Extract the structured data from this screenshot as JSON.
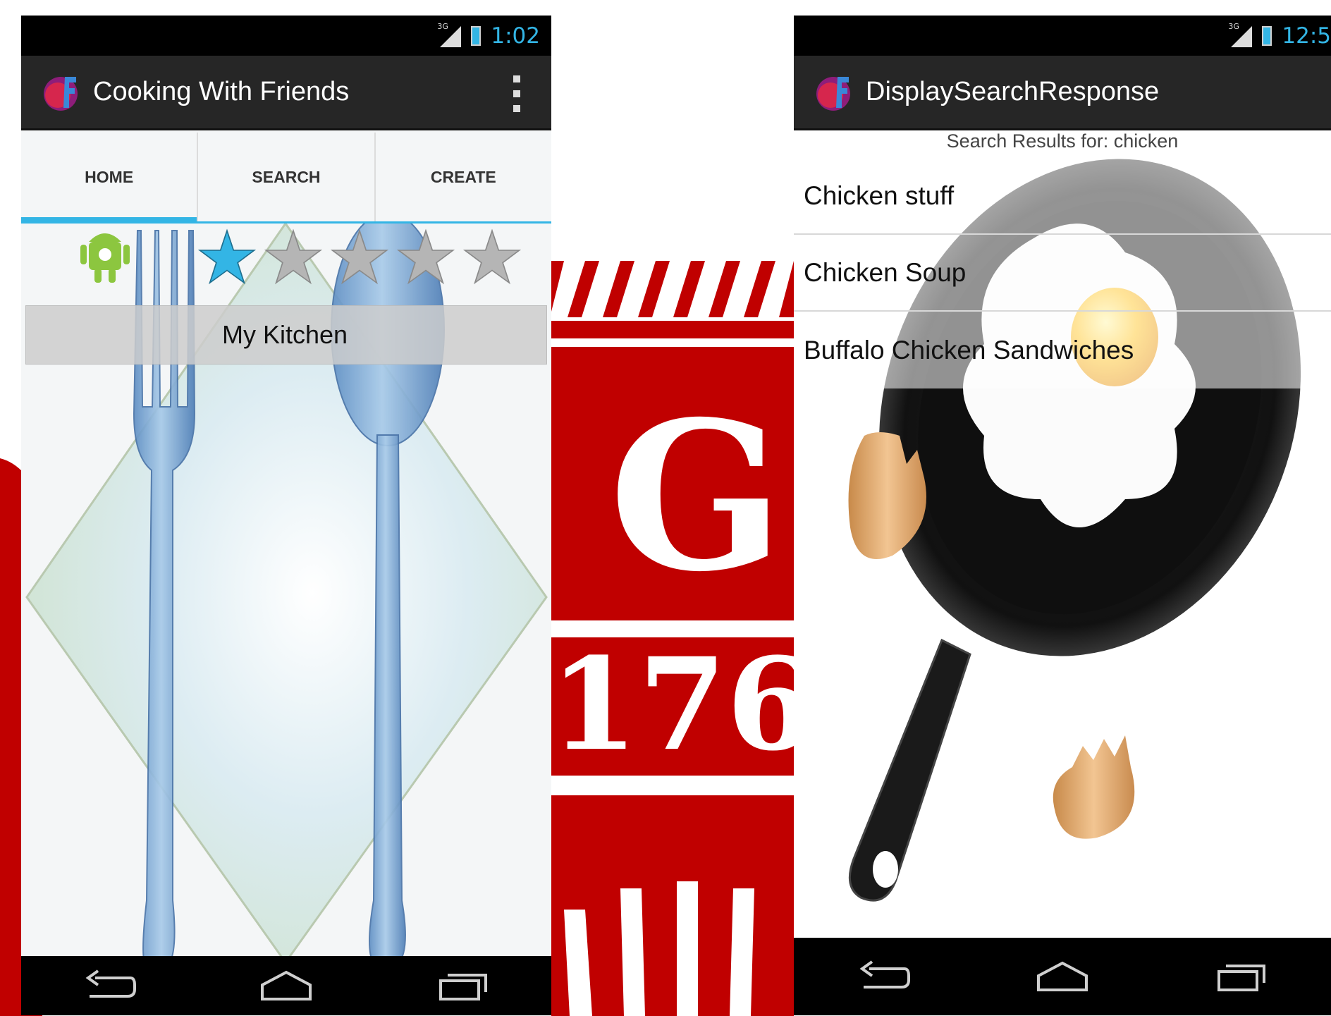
{
  "background": {
    "brand_color": "#c00000",
    "letter": "G",
    "number": "176"
  },
  "phone_home": {
    "status_time": "1:02",
    "app_title": "Cooking With Friends",
    "tabs": [
      {
        "label": "HOME",
        "active": true
      },
      {
        "label": "SEARCH",
        "active": false
      },
      {
        "label": "CREATE",
        "active": false
      }
    ],
    "rating": {
      "value": 1,
      "max": 5
    },
    "my_kitchen_label": "My Kitchen",
    "nav_icons": [
      "back-icon",
      "home-icon",
      "recent-apps-icon"
    ]
  },
  "phone_search": {
    "status_time": "12:5",
    "activity_title": "DisplaySearchResponse",
    "caption": "Search Results for: chicken",
    "results": [
      {
        "title": "Chicken stuff"
      },
      {
        "title": "Chicken Soup"
      },
      {
        "title": "Buffalo Chicken Sandwiches"
      }
    ],
    "nav_icons": [
      "back-icon",
      "home-icon",
      "recent-apps-icon"
    ]
  },
  "colors": {
    "accent": "#33b5e5",
    "actionbar": "#262626",
    "statusbar": "#000000"
  }
}
